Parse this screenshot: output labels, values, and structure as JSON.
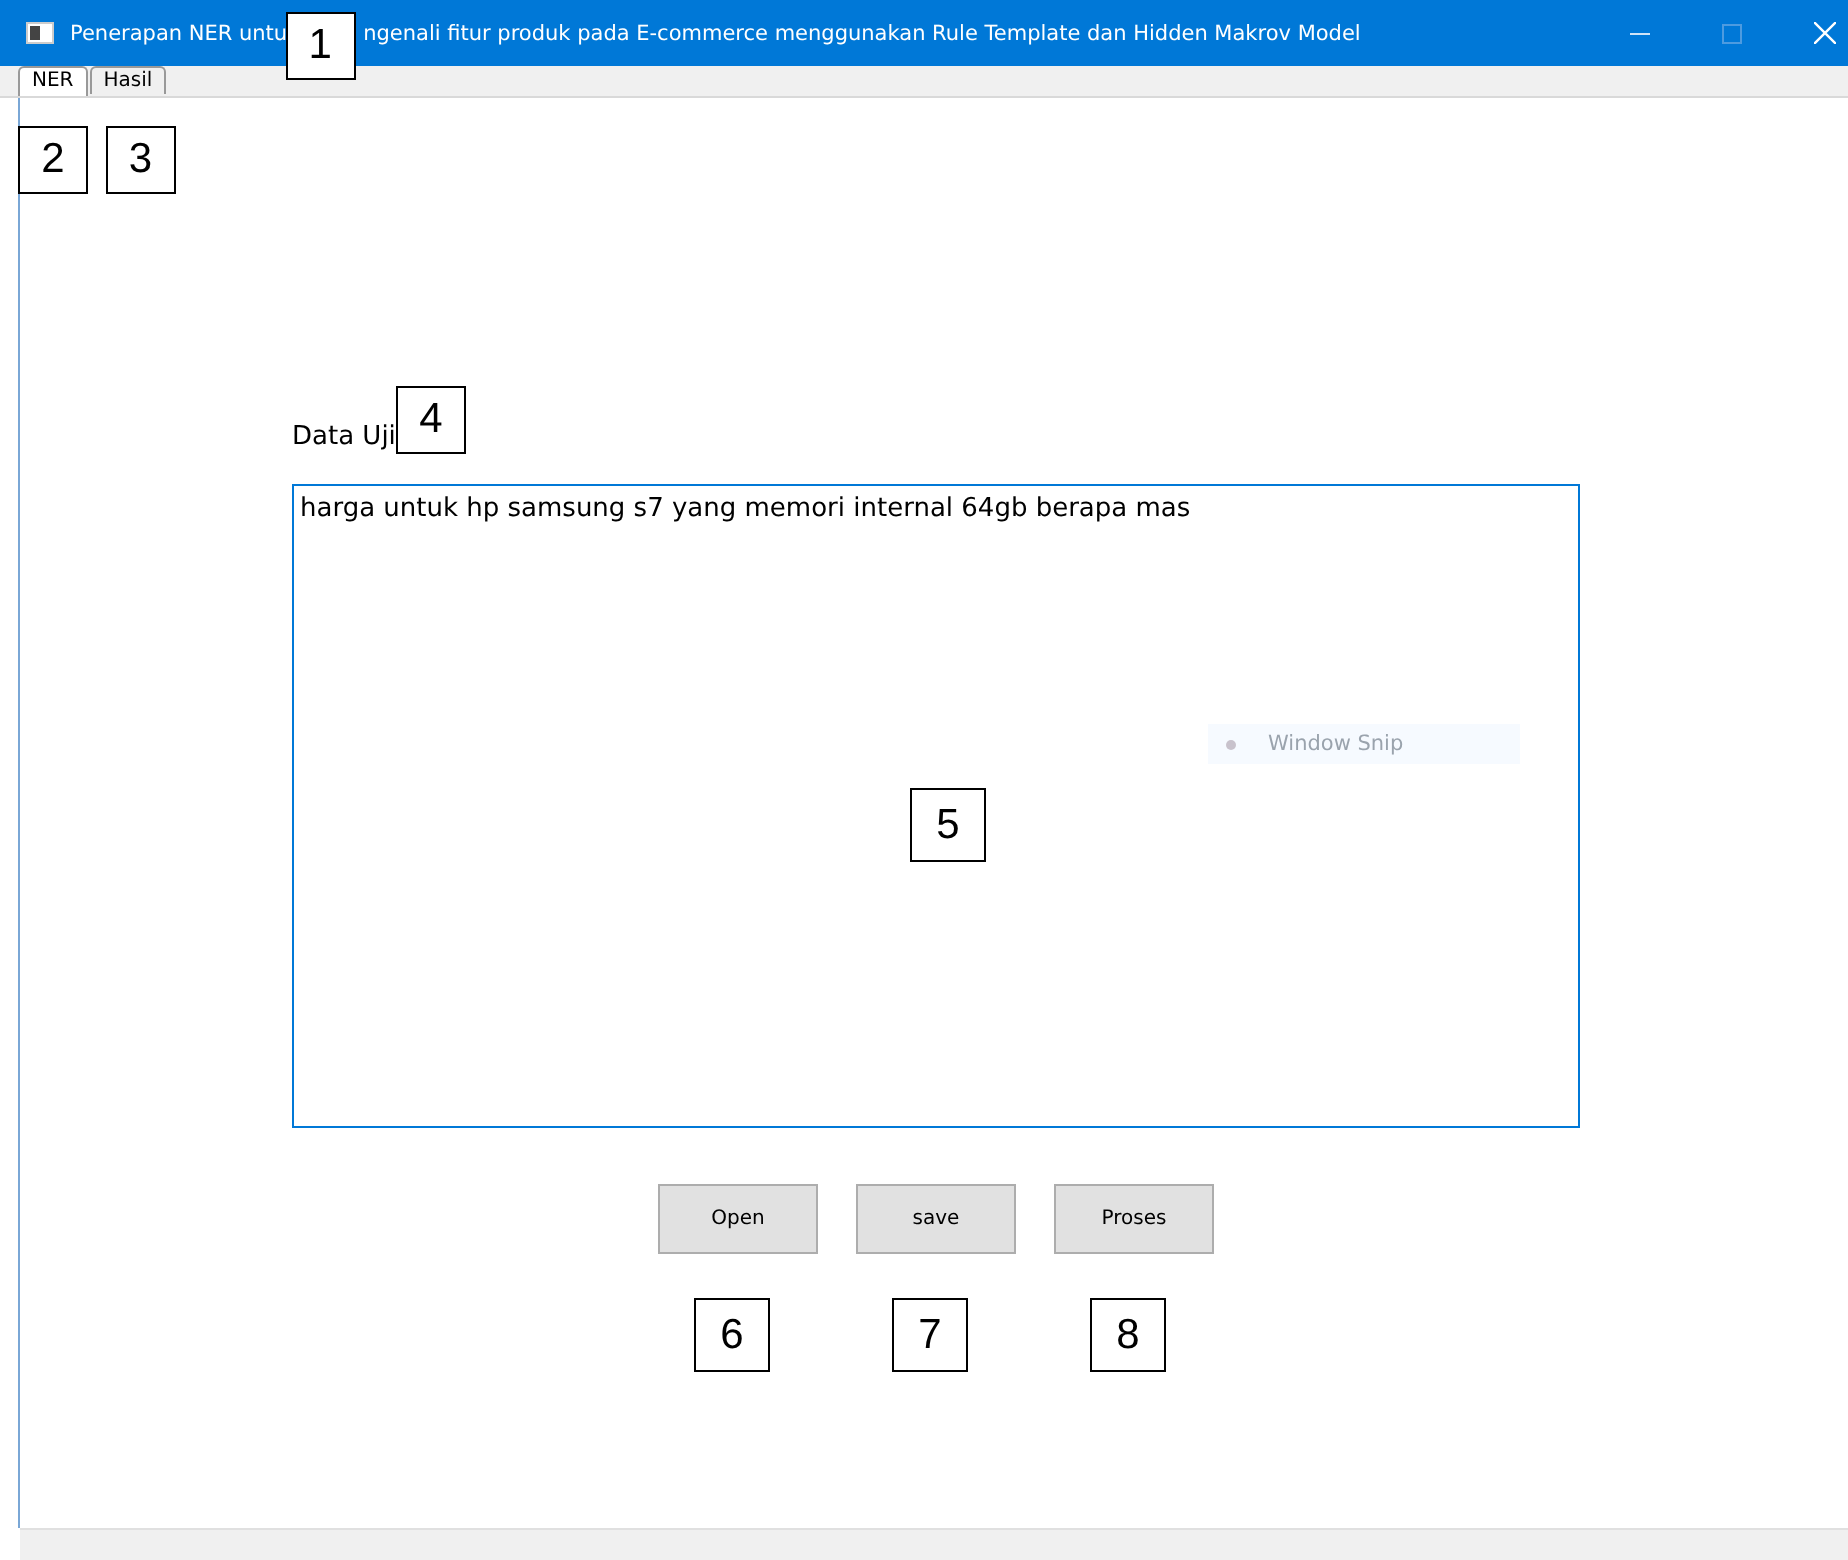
{
  "window": {
    "title_start": "Penerapan NER untu",
    "title_end": "ngenali fitur produk pada E-commerce menggunakan Rule Template dan Hidden Makrov Model",
    "callout": "1"
  },
  "tabs": [
    {
      "label": "NER",
      "selected": true,
      "callout": "2"
    },
    {
      "label": "Hasil",
      "selected": false,
      "callout": "3"
    }
  ],
  "field_label": {
    "text": "Data Uji",
    "callout": "4"
  },
  "text_area": {
    "value": "harga untuk hp samsung s7 yang memori internal 64gb berapa mas",
    "callout": "5"
  },
  "snip_overlay": {
    "text": "Window Snip"
  },
  "buttons": [
    {
      "label": "Open",
      "callout": "6"
    },
    {
      "label": "save",
      "callout": "7"
    },
    {
      "label": "Proses",
      "callout": "8"
    }
  ]
}
